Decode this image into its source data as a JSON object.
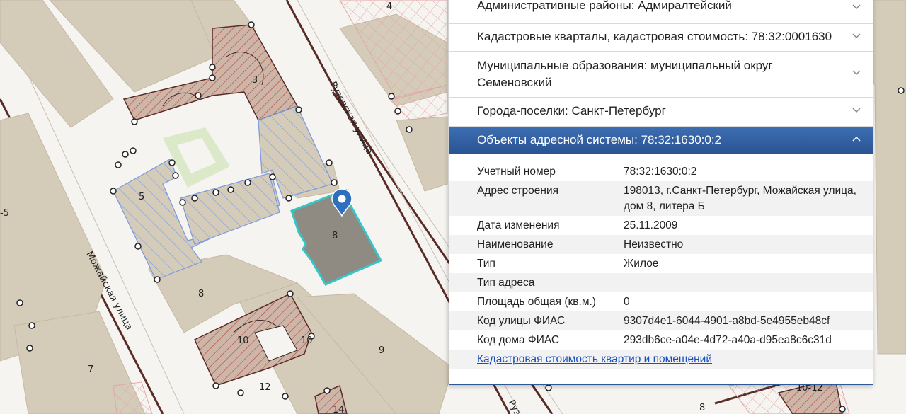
{
  "map": {
    "colors": {
      "background": "#f6f4f0",
      "building": "#d4cbb9",
      "hatched_parcel": "#a44840",
      "blue_parcel": "#6f8fd6",
      "selected_fill": "#8f8a82",
      "selected_outline": "#36c6c8",
      "green_area": "#dce9c9",
      "road_line": "#5a2b26",
      "marker": "#2f6fc0"
    },
    "labels": {
      "l4": "4",
      "l3": "3",
      "l5": "5",
      "l_5": "-5",
      "l8_selected": "8",
      "l8": "8",
      "l7": "7",
      "l9": "9",
      "l10a": "10",
      "l10b": "10",
      "l12": "12",
      "l14": "14",
      "l10_12": "10-12",
      "l8_bottom": "8"
    },
    "streets": {
      "ruzovskaya": "Рузовская улица",
      "mozhayskaya": "Можайская улица",
      "ruz_bottom": "Рузов"
    },
    "marker_icon": "map-pin-icon"
  },
  "panel": {
    "sections": [
      {
        "label": "Административные районы: Адмиралтейский",
        "icon": "chevron-down-icon"
      },
      {
        "label": "Кадастровые кварталы, кадастровая стоимость: 78:32:0001630",
        "icon": "chevron-down-icon"
      },
      {
        "label": "Муниципальные образования: муниципальный округ Семеновский",
        "icon": "chevron-down-icon"
      },
      {
        "label": "Города-поселки: Санкт-Петербург",
        "icon": "chevron-down-icon"
      }
    ],
    "active_section": {
      "label": "Объекты адресной системы: 78:32:1630:0:2",
      "icon": "chevron-up-icon"
    },
    "details": [
      {
        "key": "Учетный номер",
        "value": "78:32:1630:0:2"
      },
      {
        "key": "Адрес строения",
        "value": "198013, г.Санкт-Петербург, Можайская улица, дом 8, литера Б"
      },
      {
        "key": "Дата изменения",
        "value": "25.11.2009"
      },
      {
        "key": "Наименование",
        "value": "Неизвестно"
      },
      {
        "key": "Тип",
        "value": "Жилое"
      },
      {
        "key": "Тип адреса",
        "value": ""
      },
      {
        "key": "Площадь общая (кв.м.)",
        "value": "0"
      },
      {
        "key": "Код улицы ФИАС",
        "value": "9307d4e1-6044-4901-a8bd-5e4955eb48cf"
      },
      {
        "key": "Код дома ФИАС",
        "value": "293db6ce-a04e-4d72-a40a-d95ea8c6c31d"
      }
    ],
    "link": "Кадастровая стоимость квартир и помещений"
  }
}
